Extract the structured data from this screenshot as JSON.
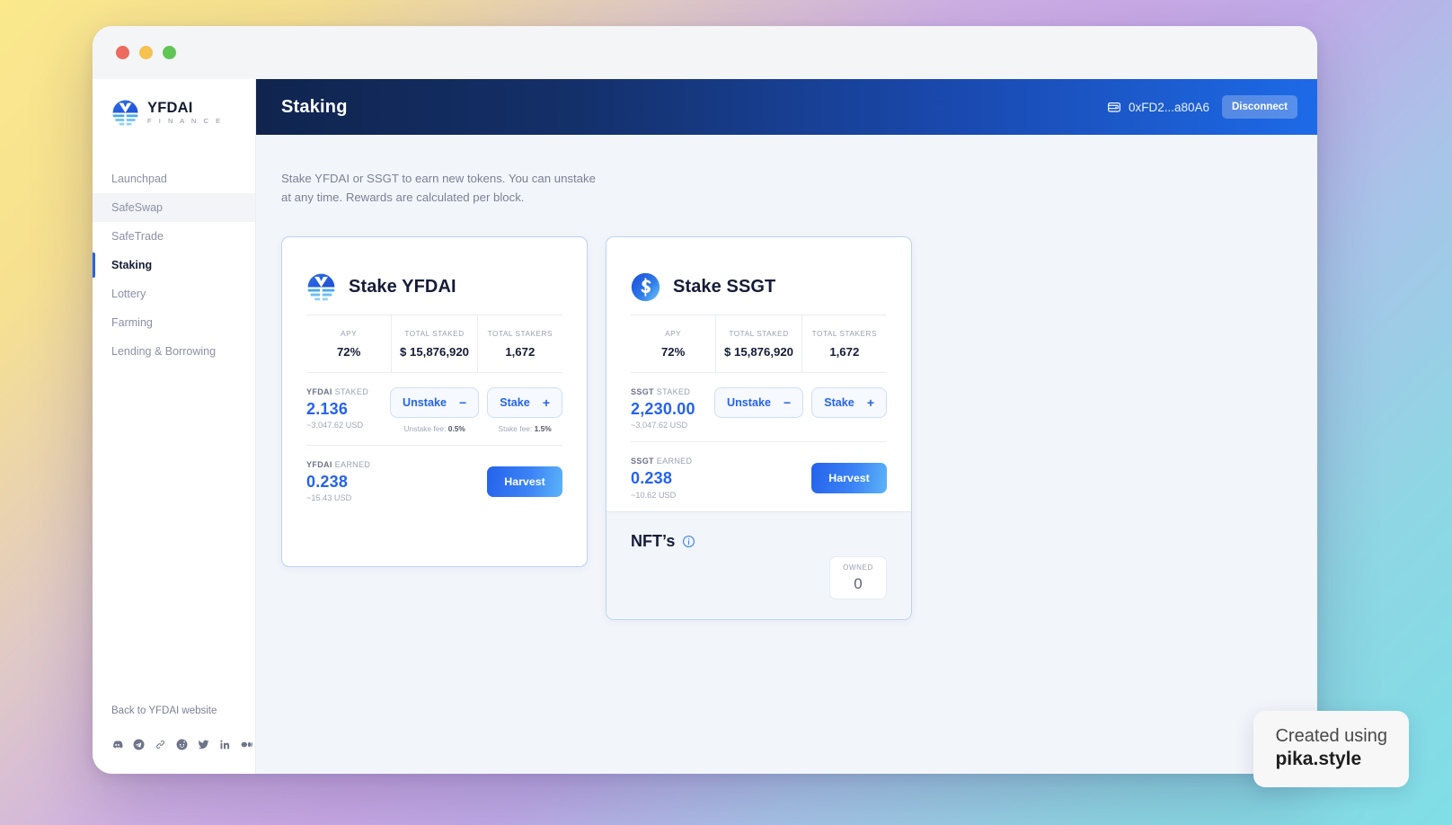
{
  "window": {
    "traffic_lights": [
      "close",
      "minimize",
      "zoom"
    ]
  },
  "sidebar": {
    "logo": {
      "name": "YFDAI",
      "subtitle": "F I N A N C E",
      "icon": "yfdai-logo-icon"
    },
    "items": [
      {
        "label": "Launchpad",
        "state": "default"
      },
      {
        "label": "SafeSwap",
        "state": "hover"
      },
      {
        "label": "SafeTrade",
        "state": "default"
      },
      {
        "label": "Staking",
        "state": "active"
      },
      {
        "label": "Lottery",
        "state": "default"
      },
      {
        "label": "Farming",
        "state": "default"
      },
      {
        "label": "Lending & Borrowing",
        "state": "default"
      }
    ],
    "footer": {
      "back_link": "Back to YFDAI website",
      "socials": [
        "discord-icon",
        "telegram-icon",
        "link-icon",
        "reddit-icon",
        "twitter-icon",
        "linkedin-icon",
        "medium-icon"
      ]
    }
  },
  "topbar": {
    "title": "Staking",
    "wallet_icon": "wallet-icon",
    "wallet_address": "0xFD2...a80A6",
    "disconnect_label": "Disconnect"
  },
  "main": {
    "description": "Stake YFDAI or SSGT to earn new tokens. You can unstake at any time. Rewards are calculated per block."
  },
  "cards": [
    {
      "id": "yfdai",
      "icon": "yfdai-coin-icon",
      "title": "Stake YFDAI",
      "stats": [
        {
          "label": "APY",
          "value": "72%"
        },
        {
          "label": "TOTAL STAKED",
          "value": "$ 15,876,920"
        },
        {
          "label": "TOTAL STAKERS",
          "value": "1,672"
        }
      ],
      "staked": {
        "token": "YFDAI",
        "label_suffix": "STAKED",
        "value": "2.136",
        "usd": "~3,047.62 USD"
      },
      "unstake_button": {
        "label": "Unstake",
        "sign": "−"
      },
      "stake_button": {
        "label": "Stake",
        "sign": "+"
      },
      "unstake_fee": {
        "text": "Unstake fee:",
        "value": "0.5%"
      },
      "stake_fee": {
        "text": "Stake fee:",
        "value": "1.5%"
      },
      "earned": {
        "token": "YFDAI",
        "label_suffix": "EARNED",
        "value": "0.238",
        "usd": "~15.43 USD"
      },
      "harvest_button": "Harvest"
    },
    {
      "id": "ssgt",
      "icon": "ssgt-coin-icon",
      "title": "Stake SSGT",
      "stats": [
        {
          "label": "APY",
          "value": "72%"
        },
        {
          "label": "TOTAL STAKED",
          "value": "$ 15,876,920"
        },
        {
          "label": "TOTAL STAKERS",
          "value": "1,672"
        }
      ],
      "staked": {
        "token": "SSGT",
        "label_suffix": "STAKED",
        "value": "2,230.00",
        "usd": "~3,047.62 USD"
      },
      "unstake_button": {
        "label": "Unstake",
        "sign": "−"
      },
      "stake_button": {
        "label": "Stake",
        "sign": "+"
      },
      "earned": {
        "token": "SSGT",
        "label_suffix": "EARNED",
        "value": "0.238",
        "usd": "~10.62 USD"
      },
      "harvest_button": "Harvest",
      "nft": {
        "title": "NFT’s",
        "info_icon": "info-icon",
        "owned_label": "OWNED",
        "owned_value": "0"
      }
    }
  ],
  "watermark": {
    "line1": "Created using",
    "line2": "pika.style"
  },
  "colors": {
    "accent_blue": "#2563eb",
    "navy": "#151c36",
    "muted": "#9aa0b3",
    "card_border": "#bcd2f5",
    "page_bg": "#f2f5fa"
  }
}
